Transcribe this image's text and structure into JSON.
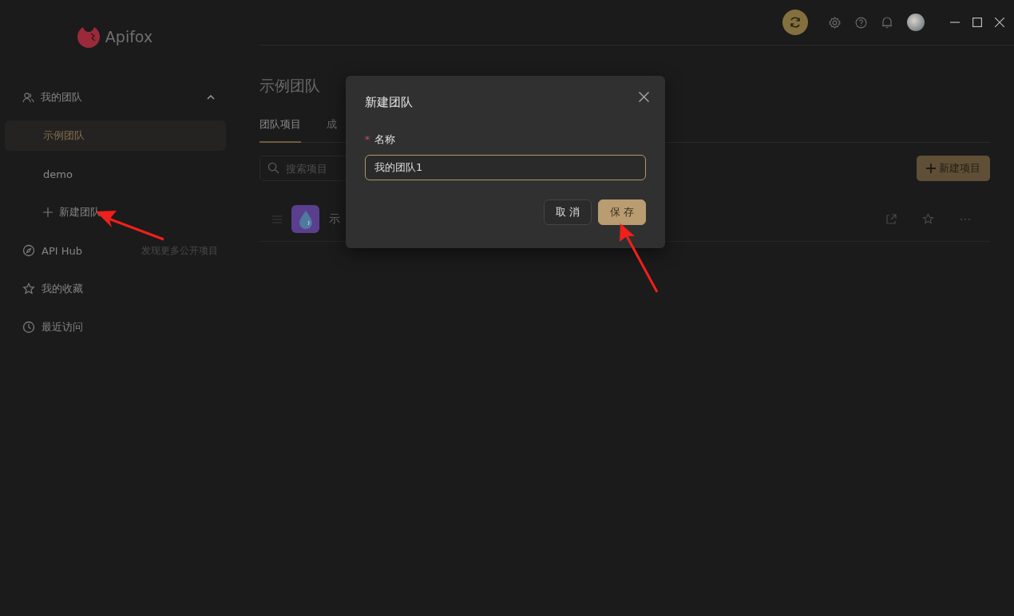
{
  "logo": {
    "name": "Apifox"
  },
  "sidebar": {
    "team_group": {
      "label": "我的团队",
      "expanded": true,
      "teams": [
        {
          "label": "示例团队",
          "selected": true
        },
        {
          "label": "demo",
          "selected": false
        }
      ],
      "new_team": "新建团队"
    },
    "items": [
      {
        "kind": "hub",
        "label": "API Hub",
        "hint": "发现更多公开项目"
      },
      {
        "kind": "favorites",
        "label": "我的收藏"
      },
      {
        "kind": "recent",
        "label": "最近访问"
      }
    ]
  },
  "main": {
    "title": "示例团队",
    "tabs": [
      {
        "label": "团队项目",
        "selected": true
      },
      {
        "label": "成",
        "selected": false
      }
    ],
    "search": {
      "placeholder": "搜索项目"
    },
    "new_project_button": "新建项目",
    "projects": [
      {
        "name": "示"
      }
    ]
  },
  "dialog": {
    "title": "新建团队",
    "field": {
      "required_mark": "*",
      "label": "名称",
      "value": "我的团队1"
    },
    "buttons": [
      {
        "label": "取 消",
        "kind": "secondary"
      },
      {
        "label": "保 存",
        "kind": "primary"
      }
    ]
  }
}
